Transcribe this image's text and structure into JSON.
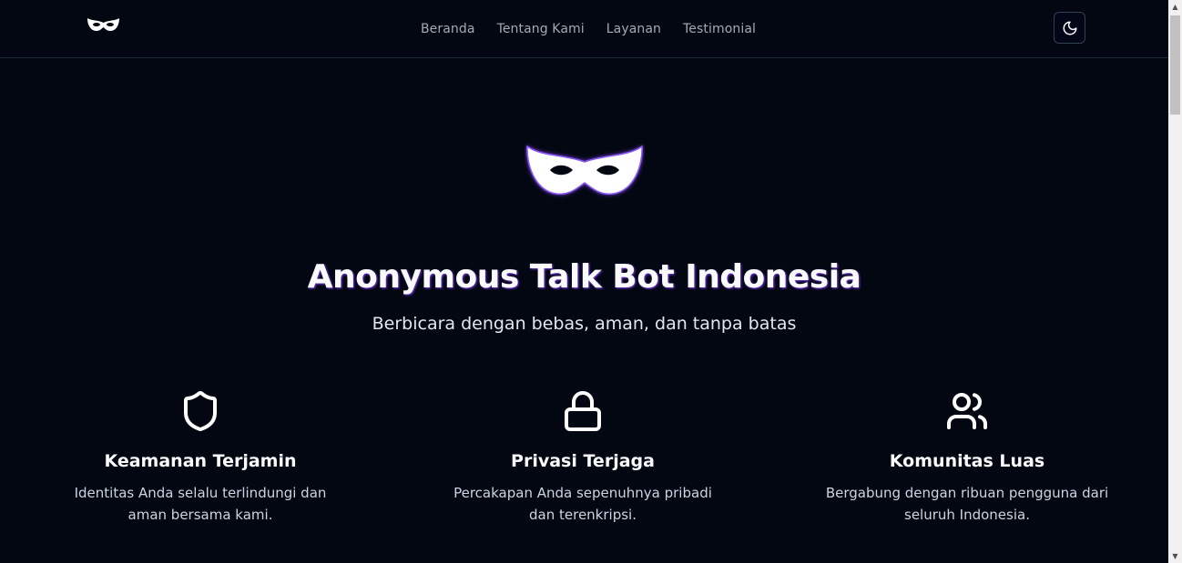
{
  "header": {
    "nav": [
      "Beranda",
      "Tentang Kami",
      "Layanan",
      "Testimonial"
    ]
  },
  "hero": {
    "title": "Anonymous Talk Bot Indonesia",
    "subtitle": "Berbicara dengan bebas, aman, dan tanpa batas"
  },
  "features": [
    {
      "icon": "shield-icon",
      "title": "Keamanan Terjamin",
      "line1": "Identitas Anda selalu terlindungi dan",
      "line2": "aman bersama kami."
    },
    {
      "icon": "lock-icon",
      "title": "Privasi Terjaga",
      "line1": "Percakapan Anda sepenuhnya pribadi",
      "line2": "dan terenkripsi."
    },
    {
      "icon": "users-icon",
      "title": "Komunitas Luas",
      "line1": "Bergabung dengan ribuan pengguna dari",
      "line2": "seluruh Indonesia."
    }
  ],
  "colors": {
    "background": "#030712",
    "accent_glow": "#7c3aed",
    "nav_text": "#a3a9b6"
  }
}
